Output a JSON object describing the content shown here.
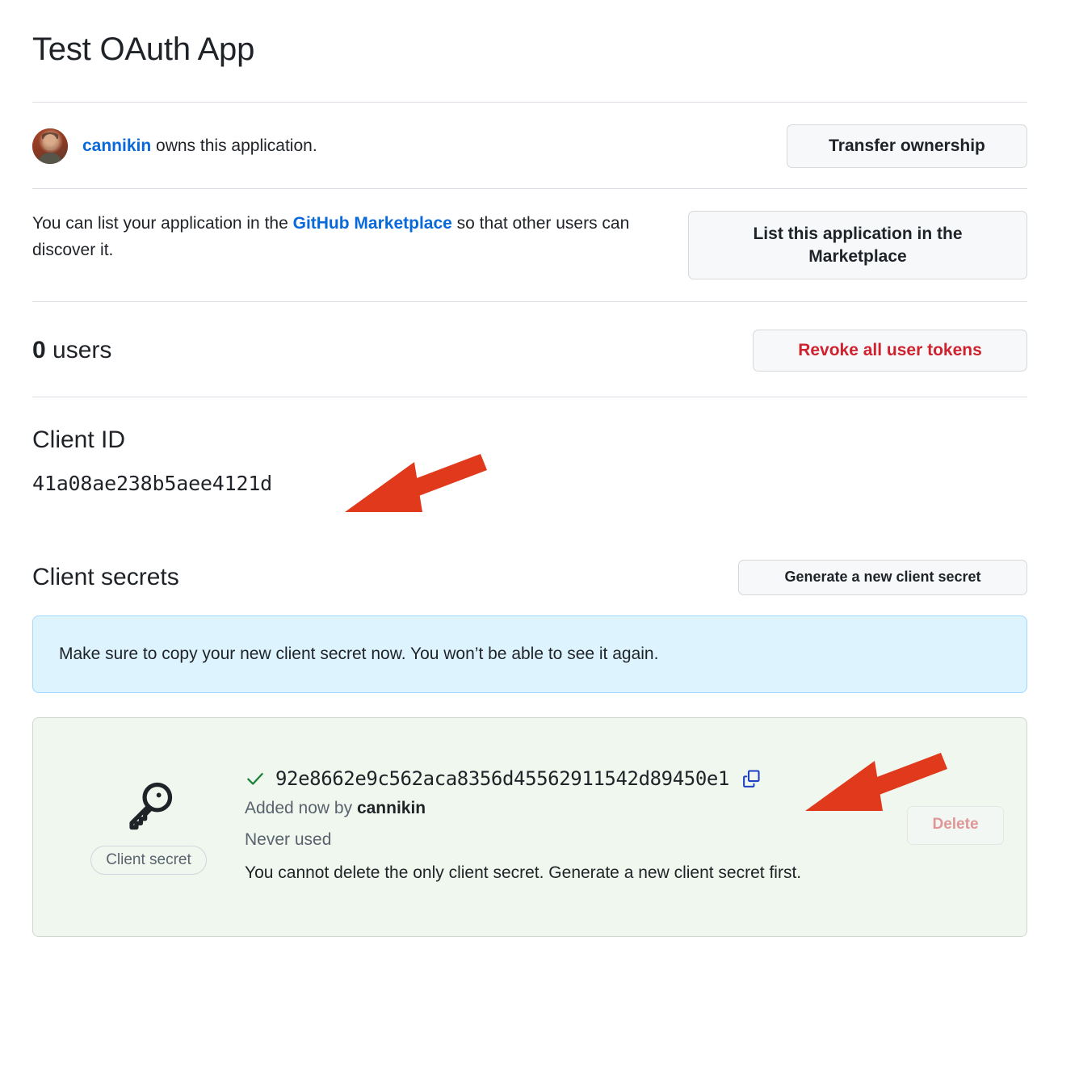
{
  "page": {
    "app_title": "Test OAuth App"
  },
  "owner": {
    "username": "cannikin",
    "suffix_text": " owns this application.",
    "avatar_alt": "cannikin avatar",
    "transfer_button": "Transfer ownership"
  },
  "marketplace": {
    "text_before": "You can list your application in the ",
    "link_text": "GitHub Marketplace",
    "text_after": " so that other users can discover it.",
    "button": "List this application in the Marketplace"
  },
  "users": {
    "count": "0",
    "label": " users",
    "revoke_button": "Revoke all user tokens"
  },
  "client_id": {
    "heading": "Client ID",
    "value": "41a08ae238b5aee4121d"
  },
  "client_secrets": {
    "heading": "Client secrets",
    "generate_button": "Generate a new client secret",
    "banner": "Make sure to copy your new client secret now. You won’t be able to see it again.",
    "secret": {
      "badge": "Client secret",
      "value": "92e8662e9c562aca8356d45562911542d89450e1",
      "added_prefix": "Added now by ",
      "added_by": "cannikin",
      "usage": "Never used",
      "note": "You cannot delete the only client secret. Generate a new client secret first.",
      "delete_button": "Delete",
      "check_icon": "check-icon",
      "copy_icon": "copy-icon",
      "key_icon": "key-icon"
    }
  },
  "annotations": {
    "arrow_color": "#e0391b",
    "arrow_1_target": "client-id-value",
    "arrow_2_target": "copy-secret-button"
  },
  "colors": {
    "link": "#0969da",
    "danger": "#cf222e",
    "banner_bg": "#ddf4ff",
    "success_bg": "#eff7ee",
    "accent_arrow": "#e0391b"
  }
}
